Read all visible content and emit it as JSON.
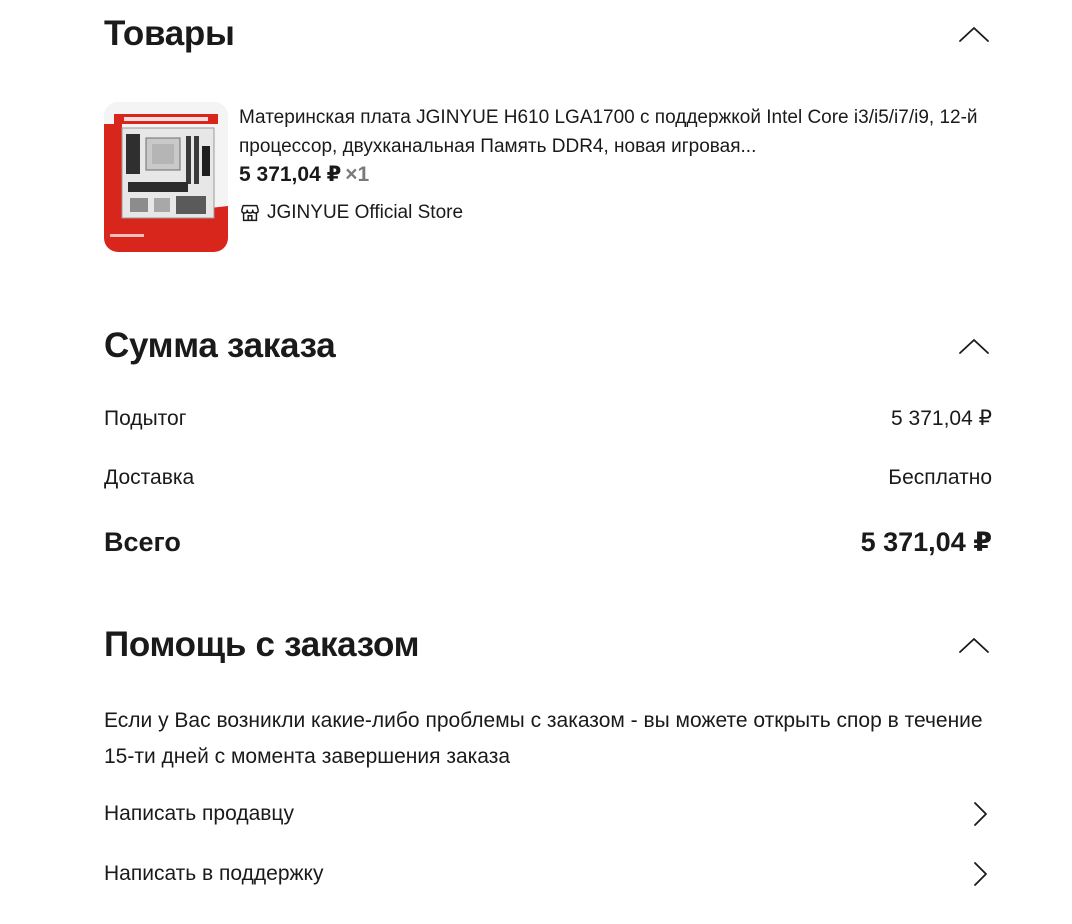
{
  "products": {
    "title": "Товары",
    "item": {
      "thumb_label": "JGINYUE Official Store",
      "name": "Материнская плата JGINYUE H610 LGA1700 с поддержкой Intel Core i3/i5/i7/i9, 12-й процессор, двухканальная Память DDR4, новая игровая...",
      "price": "5 371,04 ₽",
      "quantity": "×1",
      "store": "JGINYUE Official Store"
    }
  },
  "summary": {
    "title": "Сумма заказа",
    "subtotal_label": "Подытог",
    "subtotal_value": "5 371,04 ₽",
    "delivery_label": "Доставка",
    "delivery_value": "Бесплатно",
    "total_label": "Всего",
    "total_value": "5 371,04 ₽"
  },
  "help": {
    "title": "Помощь с заказом",
    "text": "Если у Вас возникли какие-либо проблемы с заказом - вы можете открыть спор в течение 15-ти дней с момента завершения заказа",
    "contact_seller": "Написать продавцу",
    "contact_support": "Написать в поддержку"
  },
  "icons": {
    "collapse": "chevron-up-icon",
    "navigate": "chevron-right-icon",
    "store": "store-icon"
  },
  "colors": {
    "text": "#1a1a1a",
    "muted": "#7a7a7a",
    "brand_red": "#d9261c"
  }
}
